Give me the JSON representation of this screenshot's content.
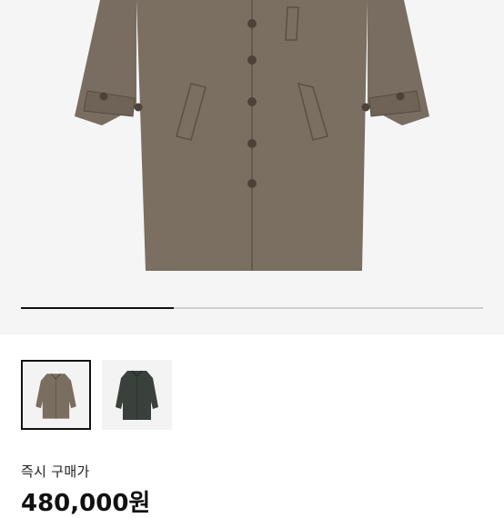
{
  "product": {
    "main_image": "brown-coat-photo",
    "gallery_progress": 0.33,
    "thumbnails": [
      {
        "image": "brown-coat-thumbnail",
        "selected": true,
        "color": "#7a6e60"
      },
      {
        "image": "dark-green-coat-thumbnail",
        "selected": false,
        "color": "#3a403c"
      }
    ]
  },
  "purchase": {
    "label": "즉시 구매가",
    "price": "480,000원"
  }
}
